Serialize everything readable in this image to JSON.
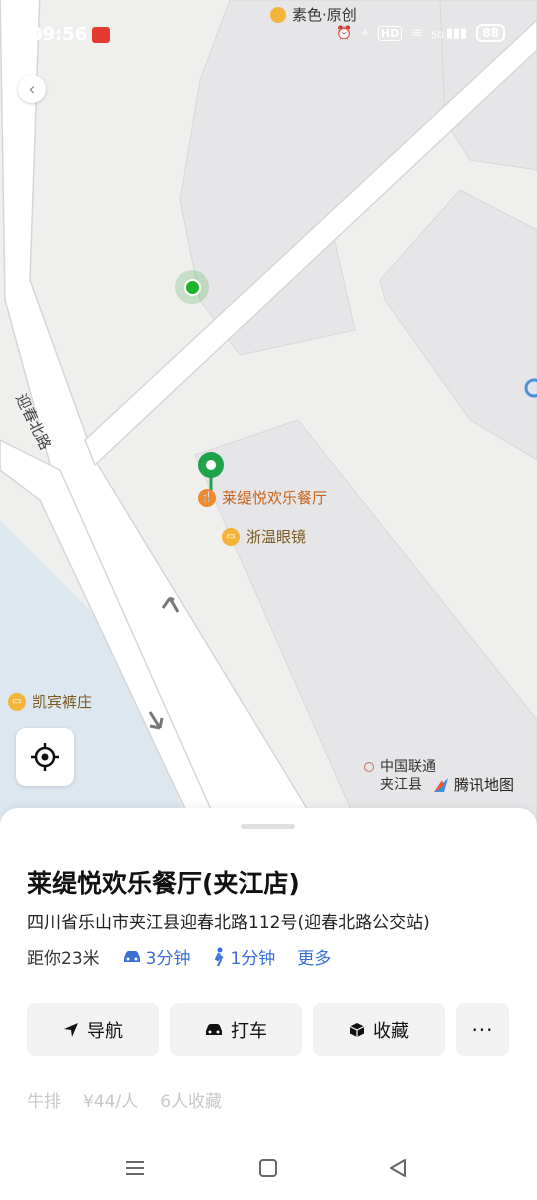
{
  "status_bar": {
    "time": "09:56",
    "notification": "素色·原创",
    "hd": "HD",
    "network": "5G",
    "battery": "88"
  },
  "map": {
    "road_label": "迎春北路",
    "poi_restaurant": "莱缇悦欢乐餐厅",
    "poi_glasses": "浙温眼镜",
    "poi_pants": "凯宾裤庄",
    "poi_unicom_1": "中国联通",
    "poi_unicom_2": "夹江县",
    "provider": "腾讯地图"
  },
  "place": {
    "name": "莱缇悦欢乐餐厅(夹江店)",
    "address": "四川省乐山市夹江县迎春北路112号(迎春北路公交站)",
    "distance": "距你23米",
    "drive_time": "3分钟",
    "walk_time": "1分钟",
    "more_label": "更多"
  },
  "actions": {
    "navigate": "导航",
    "taxi": "打车",
    "favorite": "收藏",
    "more": "···"
  },
  "tags": {
    "category": "牛排",
    "price": "¥44/人",
    "favorites": "6人收藏"
  },
  "colors": {
    "accent": "#3a6fd8",
    "pin": "#1fa34a",
    "poi_orange": "#f08a2c",
    "poi_yellow": "#f2b53a"
  }
}
